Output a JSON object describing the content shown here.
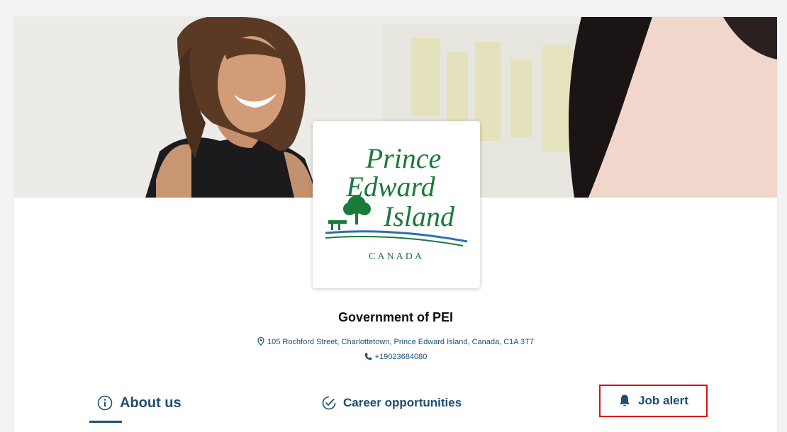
{
  "organization": {
    "name": "Government of PEI",
    "address": "105 Rochford Street, Charlottetown, Prince Edward Island, Canada, C1A 3T7",
    "phone": "+19023684080"
  },
  "logo": {
    "line1": "Prince",
    "line2": "Edward",
    "line3": "Island",
    "country": "CANADA",
    "color": "#1a7a3a"
  },
  "tabs": {
    "about": "About us",
    "career": "Career opportunities",
    "job_alert": "Job alert",
    "active": "about"
  },
  "colors": {
    "accent": "#1d4f73",
    "highlight": "#e01010"
  }
}
